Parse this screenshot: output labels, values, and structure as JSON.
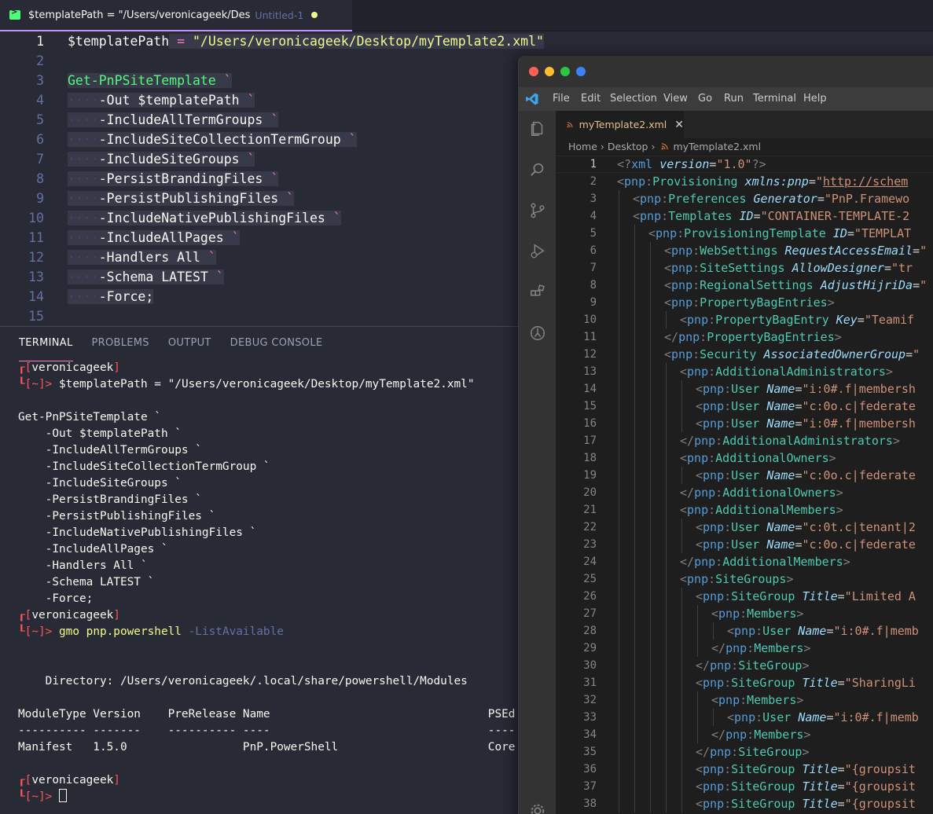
{
  "left_editor": {
    "tab_title": "$templatePath = \"/Users/veronicageek/Des",
    "tab_subtitle": "Untitled-1",
    "lines": [
      {
        "num": "1",
        "text": "$templatePath = \"/Users/veronicageek/Desktop/myTemplate2.xml\""
      },
      {
        "num": "2",
        "text": ""
      },
      {
        "num": "3",
        "text": "Get-PnPSiteTemplate `"
      },
      {
        "num": "4",
        "text": "-Out $templatePath `"
      },
      {
        "num": "5",
        "text": "-IncludeAllTermGroups `"
      },
      {
        "num": "6",
        "text": "-IncludeSiteCollectionTermGroup `"
      },
      {
        "num": "7",
        "text": "-IncludeSiteGroups `"
      },
      {
        "num": "8",
        "text": "-PersistBrandingFiles `"
      },
      {
        "num": "9",
        "text": "-PersistPublishingFiles `"
      },
      {
        "num": "10",
        "text": "-IncludeNativePublishingFiles `"
      },
      {
        "num": "11",
        "text": "-IncludeAllPages `"
      },
      {
        "num": "12",
        "text": "-Handlers All `"
      },
      {
        "num": "13",
        "text": "-Schema LATEST `"
      },
      {
        "num": "14",
        "text": "-Force;"
      },
      {
        "num": "15",
        "text": ""
      }
    ]
  },
  "terminal": {
    "tabs": [
      "TERMINAL",
      "PROBLEMS",
      "OUTPUT",
      "DEBUG CONSOLE"
    ],
    "prompt_user": "veronicageek",
    "prompt_dir": "~",
    "command1": "$templatePath = \"/Users/veronicageek/Desktop/myTemplate2.xml\"",
    "echo_lines": [
      "Get-PnPSiteTemplate `",
      "    -Out $templatePath `",
      "    -IncludeAllTermGroups `",
      "    -IncludeSiteCollectionTermGroup `",
      "    -IncludeSiteGroups `",
      "    -PersistBrandingFiles `",
      "    -PersistPublishingFiles `",
      "    -IncludeNativePublishingFiles `",
      "    -IncludeAllPages `",
      "    -Handlers All `",
      "    -Schema LATEST `",
      "    -Force;"
    ],
    "command2_name": "gmo pnp.powershell",
    "command2_arg": "-ListAvailable",
    "directory_line": "    Directory: /Users/veronicageek/.local/share/powershell/Modules",
    "table_header": "ModuleType Version    PreRelease Name                                PSEd",
    "table_rule": "---------- -------    ---------- ----                                ----",
    "table_row": "Manifest   1.5.0                 PnP.PowerShell                      Core"
  },
  "vscode": {
    "menu": [
      "File",
      "Edit",
      "Selection",
      "View",
      "Go",
      "Run",
      "Terminal",
      "Help"
    ],
    "tab_label": "myTemplate2.xml",
    "breadcrumb": [
      "Home",
      "Desktop",
      "myTemplate2.xml"
    ],
    "xml_lines": [
      {
        "num": "1",
        "indent": 0,
        "kind": "pi",
        "name": "xml",
        "attr": "version",
        "val": "1.0"
      },
      {
        "num": "2",
        "indent": 0,
        "kind": "open",
        "name": "Provisioning",
        "attr": "xmlns:pnp",
        "val": "http://schem",
        "link": true
      },
      {
        "num": "3",
        "indent": 1,
        "kind": "open",
        "name": "Preferences",
        "attr": "Generator",
        "val": "PnP.Framewo"
      },
      {
        "num": "4",
        "indent": 1,
        "kind": "open",
        "name": "Templates",
        "attr": "ID",
        "val": "CONTAINER-TEMPLATE-2"
      },
      {
        "num": "5",
        "indent": 2,
        "kind": "open",
        "name": "ProvisioningTemplate",
        "attr": "ID",
        "val": "TEMPLAT"
      },
      {
        "num": "6",
        "indent": 3,
        "kind": "open",
        "name": "WebSettings",
        "attr": "RequestAccessEmail",
        "val": ""
      },
      {
        "num": "7",
        "indent": 3,
        "kind": "open",
        "name": "SiteSettings",
        "attr": "AllowDesigner",
        "val": "tr"
      },
      {
        "num": "8",
        "indent": 3,
        "kind": "open",
        "name": "RegionalSettings",
        "attr": "AdjustHijriDa",
        "val": ""
      },
      {
        "num": "9",
        "indent": 3,
        "kind": "openclose",
        "name": "PropertyBagEntries"
      },
      {
        "num": "10",
        "indent": 4,
        "kind": "open",
        "name": "PropertyBagEntry",
        "attr": "Key",
        "val": "Teamif"
      },
      {
        "num": "11",
        "indent": 3,
        "kind": "close",
        "name": "PropertyBagEntries"
      },
      {
        "num": "12",
        "indent": 3,
        "kind": "open",
        "name": "Security",
        "attr": "AssociatedOwnerGroup",
        "val": ""
      },
      {
        "num": "13",
        "indent": 4,
        "kind": "openclose",
        "name": "AdditionalAdministrators"
      },
      {
        "num": "14",
        "indent": 5,
        "kind": "open",
        "name": "User",
        "attr": "Name",
        "val": "i:0#.f|membersh"
      },
      {
        "num": "15",
        "indent": 5,
        "kind": "open",
        "name": "User",
        "attr": "Name",
        "val": "c:0o.c|federate"
      },
      {
        "num": "16",
        "indent": 5,
        "kind": "open",
        "name": "User",
        "attr": "Name",
        "val": "i:0#.f|membersh"
      },
      {
        "num": "17",
        "indent": 4,
        "kind": "close",
        "name": "AdditionalAdministrators"
      },
      {
        "num": "18",
        "indent": 4,
        "kind": "openclose",
        "name": "AdditionalOwners"
      },
      {
        "num": "19",
        "indent": 5,
        "kind": "open",
        "name": "User",
        "attr": "Name",
        "val": "c:0o.c|federate"
      },
      {
        "num": "20",
        "indent": 4,
        "kind": "close",
        "name": "AdditionalOwners"
      },
      {
        "num": "21",
        "indent": 4,
        "kind": "openclose",
        "name": "AdditionalMembers"
      },
      {
        "num": "22",
        "indent": 5,
        "kind": "open",
        "name": "User",
        "attr": "Name",
        "val": "c:0t.c|tenant|2"
      },
      {
        "num": "23",
        "indent": 5,
        "kind": "open",
        "name": "User",
        "attr": "Name",
        "val": "c:0o.c|federate"
      },
      {
        "num": "24",
        "indent": 4,
        "kind": "close",
        "name": "AdditionalMembers"
      },
      {
        "num": "25",
        "indent": 4,
        "kind": "openclose",
        "name": "SiteGroups"
      },
      {
        "num": "26",
        "indent": 5,
        "kind": "open",
        "name": "SiteGroup",
        "attr": "Title",
        "val": "Limited A"
      },
      {
        "num": "27",
        "indent": 6,
        "kind": "openclose",
        "name": "Members"
      },
      {
        "num": "28",
        "indent": 7,
        "kind": "open",
        "name": "User",
        "attr": "Name",
        "val": "i:0#.f|memb"
      },
      {
        "num": "29",
        "indent": 6,
        "kind": "close",
        "name": "Members"
      },
      {
        "num": "30",
        "indent": 5,
        "kind": "close",
        "name": "SiteGroup"
      },
      {
        "num": "31",
        "indent": 5,
        "kind": "open",
        "name": "SiteGroup",
        "attr": "Title",
        "val": "SharingLi"
      },
      {
        "num": "32",
        "indent": 6,
        "kind": "openclose",
        "name": "Members"
      },
      {
        "num": "33",
        "indent": 7,
        "kind": "open",
        "name": "User",
        "attr": "Name",
        "val": "i:0#.f|memb"
      },
      {
        "num": "34",
        "indent": 6,
        "kind": "close",
        "name": "Members"
      },
      {
        "num": "35",
        "indent": 5,
        "kind": "close",
        "name": "SiteGroup"
      },
      {
        "num": "36",
        "indent": 5,
        "kind": "open",
        "name": "SiteGroup",
        "attr": "Title",
        "val": "{groupsit"
      },
      {
        "num": "37",
        "indent": 5,
        "kind": "open",
        "name": "SiteGroup",
        "attr": "Title",
        "val": "{groupsit"
      },
      {
        "num": "38",
        "indent": 5,
        "kind": "open",
        "name": "SiteGroup",
        "attr": "Title",
        "val": "{groupsit"
      }
    ]
  },
  "colors": {
    "dracula_bg": "#282a36",
    "accent_pink": "#ff79c6",
    "accent_green": "#50fa7b",
    "accent_yellow": "#f1fa8c",
    "vscode_bg": "#1e1e1e"
  }
}
